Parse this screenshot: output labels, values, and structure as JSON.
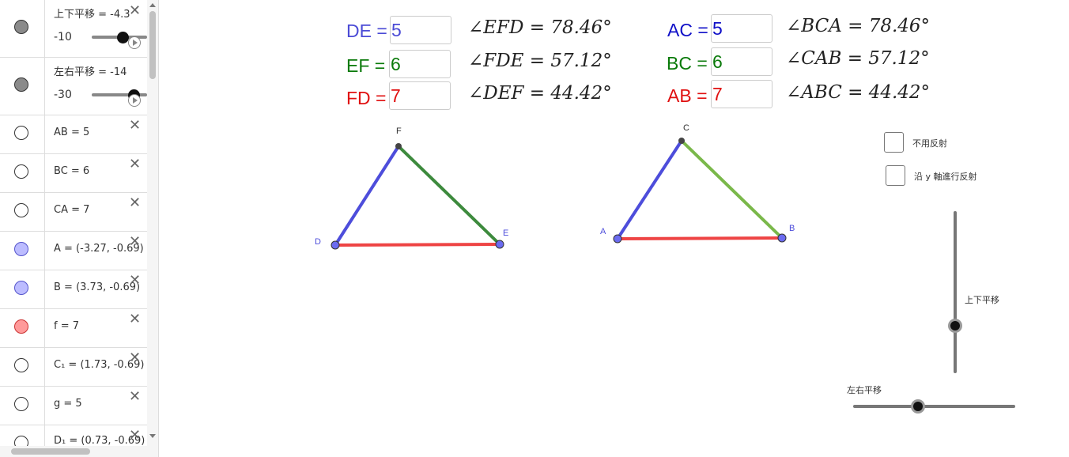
{
  "sidebar": {
    "rows": [
      {
        "text": "上下平移 = -4.3",
        "marble": "#8a8a8a",
        "slider_value": "-10",
        "has_close": true
      },
      {
        "text": "左右平移 = -14",
        "marble": "#8a8a8a",
        "slider_value": "-30",
        "has_close": false
      },
      {
        "text": "AB = 5",
        "marble": "#ffffff",
        "has_close": true
      },
      {
        "text": "BC = 6",
        "marble": "#ffffff",
        "has_close": true
      },
      {
        "text": "CA = 7",
        "marble": "#ffffff",
        "has_close": true
      },
      {
        "text": "A = (-3.27, -0.69)",
        "marble": "#bcbcff",
        "has_close": true
      },
      {
        "text": "B = (3.73, -0.69)",
        "marble": "#bcbcff",
        "has_close": true
      },
      {
        "text": "f = 7",
        "marble": "#ff9a9a",
        "has_close": true
      },
      {
        "text": "C₁ = (1.73, -0.69)",
        "marble": "#ffffff",
        "has_close": true
      },
      {
        "text": "g = 5",
        "marble": "#ffffff",
        "has_close": true
      },
      {
        "text": "D₁ = (0.73, -0.69)",
        "marble": "#ffffff",
        "has_close": true
      }
    ],
    "close_glyph": "✕"
  },
  "inputs": {
    "de": {
      "label": "DE =",
      "value": "5",
      "color": "#4b4bd6"
    },
    "ef": {
      "label": "EF =",
      "value": "6",
      "color": "#0a7a0a"
    },
    "fd": {
      "label": "FD =",
      "value": "7",
      "color": "#e01010"
    },
    "ac": {
      "label": "AC =",
      "value": "5",
      "color": "#1010c8"
    },
    "bc": {
      "label": "BC =",
      "value": "6",
      "color": "#0a7a0a"
    },
    "ab": {
      "label": "AB =",
      "value": "7",
      "color": "#e01010"
    }
  },
  "angles": {
    "efd": "∠EFD = 78.46°",
    "fde": "∠FDE = 57.12°",
    "def": "∠DEF = 44.42°",
    "bca": "∠BCA = 78.46°",
    "cab": "∠CAB = 57.12°",
    "abc": "∠ABC = 44.42°"
  },
  "points": {
    "d": "D",
    "e": "E",
    "f": "F",
    "a": "A",
    "b": "B",
    "c": "C"
  },
  "checkboxes": {
    "no_reflect": "不用反射",
    "reflect_y": "沿 y 軸進行反射"
  },
  "sliders": {
    "vertical_label": "上下平移",
    "horizontal_label": "左右平移"
  },
  "colors": {
    "blue_segment": "#4d4ddb",
    "green_dark": "#3d8a3d",
    "green_light": "#7ab84a",
    "red_segment": "#ee4444",
    "point_blue": "#6b6bf0"
  }
}
